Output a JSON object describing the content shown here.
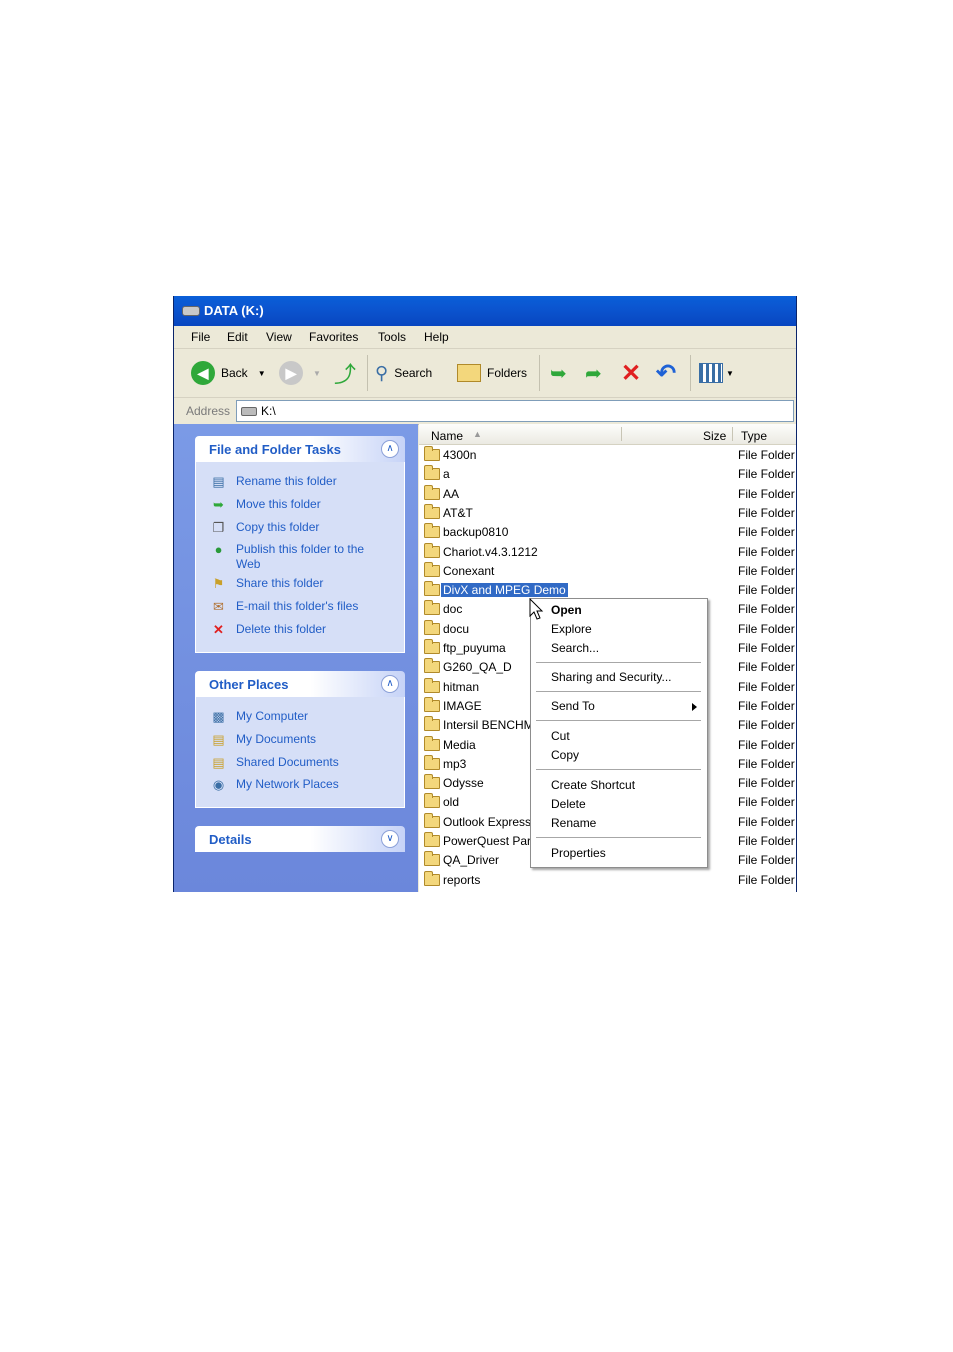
{
  "window": {
    "title": "DATA (K:)"
  },
  "menu": [
    "File",
    "Edit",
    "View",
    "Favorites",
    "Tools",
    "Help"
  ],
  "toolbar": {
    "back_label": "Back",
    "search_label": "Search",
    "folders_label": "Folders"
  },
  "address": {
    "label": "Address",
    "value": "K:\\"
  },
  "file_tasks": {
    "title": "File and Folder Tasks",
    "items": [
      {
        "label": "Rename this folder",
        "icon": "rename-icon"
      },
      {
        "label": "Move this folder",
        "icon": "move-icon"
      },
      {
        "label": "Copy this folder",
        "icon": "copy-icon"
      },
      {
        "label": "Publish this folder to the Web",
        "icon": "globe-icon"
      },
      {
        "label": "Share this folder",
        "icon": "share-icon"
      },
      {
        "label": "E-mail this folder's files",
        "icon": "email-icon"
      },
      {
        "label": "Delete this folder",
        "icon": "delete-icon"
      }
    ]
  },
  "other_places": {
    "title": "Other Places",
    "items": [
      {
        "label": "My Computer",
        "icon": "computer-icon"
      },
      {
        "label": "My Documents",
        "icon": "documents-icon"
      },
      {
        "label": "Shared Documents",
        "icon": "folder-icon"
      },
      {
        "label": "My Network Places",
        "icon": "network-icon"
      }
    ]
  },
  "details": {
    "title": "Details"
  },
  "columns": {
    "name": "Name",
    "size": "Size",
    "type": "Type"
  },
  "files": [
    {
      "name": "4300n",
      "type": "File Folder"
    },
    {
      "name": "a",
      "type": "File Folder"
    },
    {
      "name": "AA",
      "type": "File Folder"
    },
    {
      "name": "AT&T",
      "type": "File Folder"
    },
    {
      "name": "backup0810",
      "type": "File Folder"
    },
    {
      "name": "Chariot.v4.3.1212",
      "type": "File Folder"
    },
    {
      "name": "Conexant",
      "type": "File Folder"
    },
    {
      "name": "DivX and MPEG Demo",
      "type": "File Folder",
      "selected": true
    },
    {
      "name": "doc",
      "type": "File Folder"
    },
    {
      "name": "docu",
      "type": "File Folder"
    },
    {
      "name": "ftp_puyuma",
      "type": "File Folder"
    },
    {
      "name": "G260_QA_D",
      "type": "File Folder"
    },
    {
      "name": "hitman",
      "type": "File Folder"
    },
    {
      "name": "IMAGE",
      "type": "File Folder"
    },
    {
      "name": "Intersil BENCHM",
      "type": "File Folder"
    },
    {
      "name": "Media",
      "type": "File Folder"
    },
    {
      "name": "mp3",
      "type": "File Folder"
    },
    {
      "name": "Odysse",
      "type": "File Folder"
    },
    {
      "name": "old",
      "type": "File Folder"
    },
    {
      "name": "Outlook Express",
      "type": "File Folder"
    },
    {
      "name": "PowerQuest Par",
      "type": "File Folder"
    },
    {
      "name": "QA_Driver",
      "type": "File Folder"
    },
    {
      "name": "reports",
      "type": "File Folder"
    }
  ],
  "context_menu": {
    "open": "Open",
    "explore": "Explore",
    "search": "Search...",
    "sharing": "Sharing and Security...",
    "send_to": "Send To",
    "cut": "Cut",
    "copy": "Copy",
    "create_shortcut": "Create Shortcut",
    "delete": "Delete",
    "rename": "Rename",
    "properties": "Properties"
  }
}
